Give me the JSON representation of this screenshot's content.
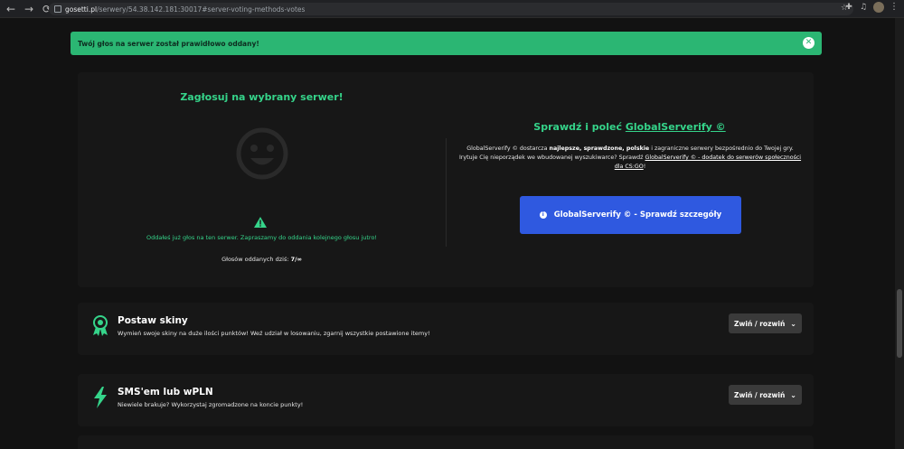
{
  "browser": {
    "url_host": "gosetti.pl",
    "url_path": "/serwery/54.38.142.181:30017#server-voting-methods-votes"
  },
  "alert": {
    "message": "Twój głos na serwer został prawidłowo oddany!",
    "close_icon": "close-icon"
  },
  "vote": {
    "title": "Zagłosuj na wybrany serwer!",
    "info": "Oddałeś już głos na ten serwer. Zapraszamy do oddania kolejnego głosu jutro!",
    "votes_today_label": "Głosów oddanych dziś:",
    "votes_today_value": "7/∞"
  },
  "globalserverify": {
    "title_prefix": "Sprawdź i poleć",
    "title_link": "GlobalServerify ©",
    "desc_part1": "GlobalServerify © dostarcza",
    "desc_bold": "najlepsze, sprawdzone, polskie",
    "desc_part2": "i zagraniczne serwery bezpośrednio do Twojej gry. Irytuje Cię nieporządek we wbudowanej wyszukiwarce? Sprawdź",
    "desc_link": "GlobalServerify © - dodatek do serwerów społeczności dla CS:GO",
    "desc_end": "!",
    "button_label": "GlobalServerify © - Sprawdź szczegóły"
  },
  "sections": [
    {
      "title": "Postaw skiny",
      "subtitle": "Wymień swoje skiny na duże ilości punktów! Weź udział w losowaniu, zgarnij wszystkie postawione itemy!",
      "toggle_label": "Zwiń / rozwiń",
      "icon": "award-icon"
    },
    {
      "title": "SMS'em lub wPLN",
      "subtitle": "Niewiele brakuje? Wykorzystaj zgromadzone na koncie punkty!",
      "toggle_label": "Zwiń / rozwiń",
      "icon": "lightning-icon"
    }
  ],
  "colors": {
    "accent_green": "#35d48a",
    "alert_green": "#2bb673",
    "button_blue": "#2f59e0",
    "background": "#121212"
  }
}
